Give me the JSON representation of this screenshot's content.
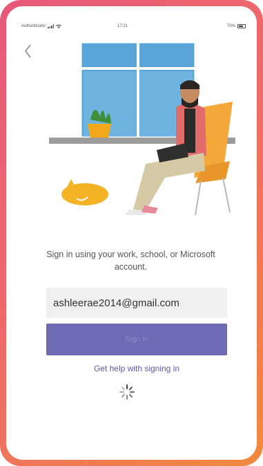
{
  "status_bar": {
    "carrier": "Authenticator",
    "time": "17:21",
    "battery": "70%"
  },
  "colors": {
    "accent": "#6264a7",
    "button_fill": "#6e6bb5",
    "link": "#5b59a8",
    "frame_gradient_start": "#e8587a",
    "frame_gradient_end": "#f08a3e"
  },
  "icons": {
    "back": "chevron-left-icon",
    "loading": "spinner-icon"
  },
  "login": {
    "prompt": "Sign in using your work, school, or Microsoft account.",
    "email_value": "ashleerae2014@gmail.com",
    "signin_label": "Sign in",
    "help_link": "Get help with signing in"
  }
}
